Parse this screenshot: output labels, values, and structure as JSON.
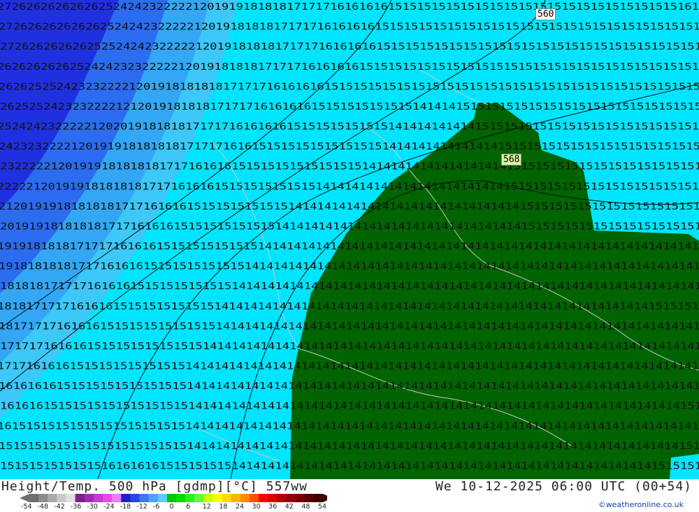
{
  "map": {
    "contour_labels": [
      {
        "id": "c560",
        "value": "560",
        "highlight": false
      },
      {
        "id": "c568",
        "value": "568",
        "highlight": true
      }
    ],
    "field_rows": [
      "2726262626262625242423222221201919181818171717161616161515151515151515151515151515151515151515161",
      "2726262626262625242423222221201918181817171716161616151515151515151515151515151515151515151515151",
      "2726262626262525242423222221201918181817171716161616151515151515151515151515151515151515151515151",
      "2626262626252424232322222120191818181717171616161615151515151515151515151515151515151515151515151",
      "2626252524232322221201918181818171717161616161515151515151515151515151515151515151515151515151515",
      "2625252423232222121201918181817171716161616151515151515151414141515151515151515151515151515151515",
      "2524242322222120201918181817171716161616151515151515151414141414141515151515151515151515151515151",
      "2423232222120191918181818171717161615151515151515151514141414141414141515151515151515151515151515",
      "2322222120191918181818171716161615151515151515151514141414141414141414151515151515151515151515151",
      "2222212019191818181817171616161515151515151514141414141414141414141414151515151515151515151515151",
      "2120191918181818171716161615151515151515141414141414141414141414141414141515151515151515151515151",
      "2019191818181817171616161515151515151514141414141414141414141414141414141515151515151515151515151",
      "1919181818171717161616151515151515151414141414141414141414141414141414141414141414141414141414141",
      "1918181818171716161615151515151515141414141414141414141414141414141414141414141414141414141414141",
      "1818181717171616161515151515151514141414141414141414141414141414141414141414141414141414141414141",
      "1818171717161616151515151515151414141414141414141414141414141414141414141414141414141414141515151",
      "1817171716161615151515151515151414141414141414141414141414141414141414141414141414141414141414141",
      "1717171616161515151515151515141414141414141414141414141414141414141414141414141414141414141414141",
      "1717161616151515151515151514141414141414141414141414141414141414141414141414141414141414141414141",
      "1616161615151515151515151514141414141414141414141414141414141414141414141414141414141414141414141",
      "1616161515151515151515151514141414141414141414141414141414141414141414141414141414141414141414151",
      "1615151515151515151515151514141414141414141414141414141414141414141414141414141414141414141414141",
      "1515151515151515151515151514141414141414141414141414141414141414141414141414141414141414141414151",
      "1515151515151516161616151515151514141414141414141414141414141414141414141414141414141414141515151"
    ]
  },
  "footer": {
    "title": "Height/Temp. 500 hPa [gdmp][°C] 557ww",
    "datetime": "We 10-12-2025 06:00 UTC (00+54)",
    "credit": "©weatheronline.co.uk",
    "legend": {
      "labels": [
        "-54",
        "-48",
        "-42",
        "-36",
        "-30",
        "-24",
        "-18",
        "-12",
        "-6",
        "0",
        "6",
        "12",
        "18",
        "24",
        "30",
        "36",
        "42",
        "48",
        "54"
      ],
      "colors": [
        "#6e6e6e",
        "#8c8c8c",
        "#aaaaaa",
        "#c8c8c8",
        "#e0e0e0",
        "#7a1e8c",
        "#9b2db4",
        "#c03cd2",
        "#e050e6",
        "#f07cf0",
        "#2020c8",
        "#2846e6",
        "#3c78f0",
        "#50a0f5",
        "#64c8fa",
        "#00c800",
        "#00dc00",
        "#28f028",
        "#64ff32",
        "#c8ff00",
        "#ffff00",
        "#ffdc00",
        "#ffb400",
        "#ff8c00",
        "#ff5000",
        "#ff0000",
        "#dc0000",
        "#b40000",
        "#960000",
        "#780000",
        "#5a0000",
        "#3c0000"
      ]
    }
  }
}
